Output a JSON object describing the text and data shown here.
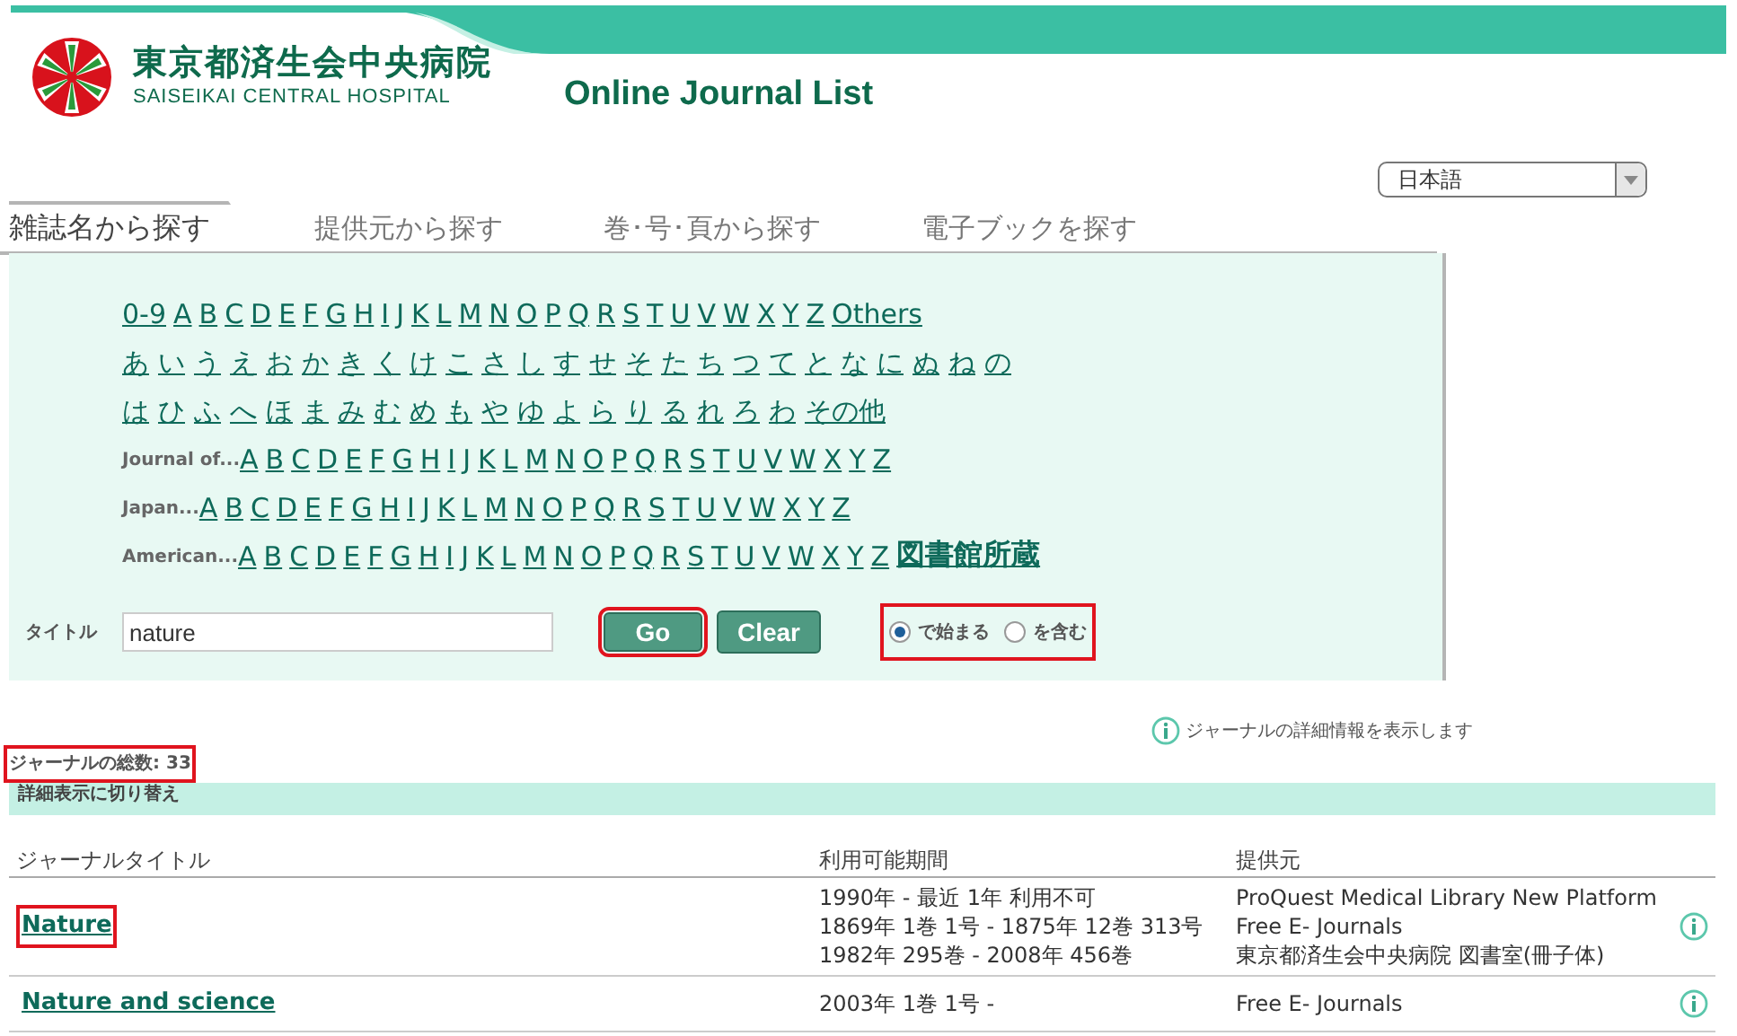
{
  "header": {
    "hospital_name": "東京都済生会中央病院",
    "hospital_name_en": "SAISEIKAI CENTRAL HOSPITAL",
    "title": "Online Journal List"
  },
  "language_select": {
    "value": "日本語"
  },
  "tabs": [
    {
      "label": "雑誌名から探す",
      "selected": true
    },
    {
      "label": "提供元から探す",
      "selected": false
    },
    {
      "label": "巻･号･頁から探す",
      "selected": false
    },
    {
      "label": "電子ブックを探す",
      "selected": false
    }
  ],
  "index_rows": [
    {
      "prefix": "",
      "links": [
        "0-9",
        "A",
        "B",
        "C",
        "D",
        "E",
        "F",
        "G",
        "H",
        "I",
        "J",
        "K",
        "L",
        "M",
        "N",
        "O",
        "P",
        "Q",
        "R",
        "S",
        "T",
        "U",
        "V",
        "W",
        "X",
        "Y",
        "Z",
        "Others"
      ]
    },
    {
      "prefix": "",
      "links": [
        "あ",
        "い",
        "う",
        "え",
        "お",
        "か",
        "き",
        "く",
        "け",
        "こ",
        "さ",
        "し",
        "す",
        "せ",
        "そ",
        "た",
        "ち",
        "つ",
        "て",
        "と",
        "な",
        "に",
        "ぬ",
        "ね",
        "の"
      ]
    },
    {
      "prefix": "",
      "links": [
        "は",
        "ひ",
        "ふ",
        "へ",
        "ほ",
        "ま",
        "み",
        "む",
        "め",
        "も",
        "や",
        "ゆ",
        "よ",
        "ら",
        "り",
        "る",
        "れ",
        "ろ",
        "わ",
        "その他"
      ]
    },
    {
      "prefix": "Journal of...",
      "links": [
        "A",
        "B",
        "C",
        "D",
        "E",
        "F",
        "G",
        "H",
        "I",
        "J",
        "K",
        "L",
        "M",
        "N",
        "O",
        "P",
        "Q",
        "R",
        "S",
        "T",
        "U",
        "V",
        "W",
        "X",
        "Y",
        "Z"
      ]
    },
    {
      "prefix": "Japan...",
      "links": [
        "A",
        "B",
        "C",
        "D",
        "E",
        "F",
        "G",
        "H",
        "I",
        "J",
        "K",
        "L",
        "M",
        "N",
        "O",
        "P",
        "Q",
        "R",
        "S",
        "T",
        "U",
        "V",
        "W",
        "X",
        "Y",
        "Z"
      ]
    },
    {
      "prefix": "American...",
      "links": [
        "A",
        "B",
        "C",
        "D",
        "E",
        "F",
        "G",
        "H",
        "I",
        "J",
        "K",
        "L",
        "M",
        "N",
        "O",
        "P",
        "Q",
        "R",
        "S",
        "T",
        "U",
        "V",
        "W",
        "X",
        "Y",
        "Z",
        "図書館所蔵"
      ]
    }
  ],
  "search": {
    "label": "タイトル",
    "value": "nature",
    "go": {
      "label": "Go",
      "highlighted": true
    },
    "clear": {
      "label": "Clear",
      "highlighted": false
    },
    "match_options": {
      "highlighted": true,
      "options": [
        {
          "label": "で始まる",
          "selected": true
        },
        {
          "label": "を含む",
          "selected": false
        }
      ]
    }
  },
  "info_legend": "ジャーナルの詳細情報を表示します",
  "total": {
    "text": "ジャーナルの総数: 33",
    "highlighted": true
  },
  "toggle_detail": "詳細表示に切り替え",
  "table": {
    "columns": [
      "ジャーナルタイトル",
      "利用可能期間",
      "提供元"
    ],
    "rows": [
      {
        "title": "Nature",
        "highlighted": true,
        "periods": [
          "1990年 - 最近 1年 利用不可",
          "1869年 1巻 1号 - 1875年 12巻 313号",
          "1982年 295巻 - 2008年 456巻"
        ],
        "providers": [
          "ProQuest Medical Library New Platform",
          "Free E- Journals",
          "東京都済生会中央病院 図書室(冊子体)"
        ]
      },
      {
        "title": "Nature and science",
        "highlighted": false,
        "periods": [
          "2003年 1巻 1号 -"
        ],
        "providers": [
          "Free E- Journals"
        ]
      }
    ]
  }
}
